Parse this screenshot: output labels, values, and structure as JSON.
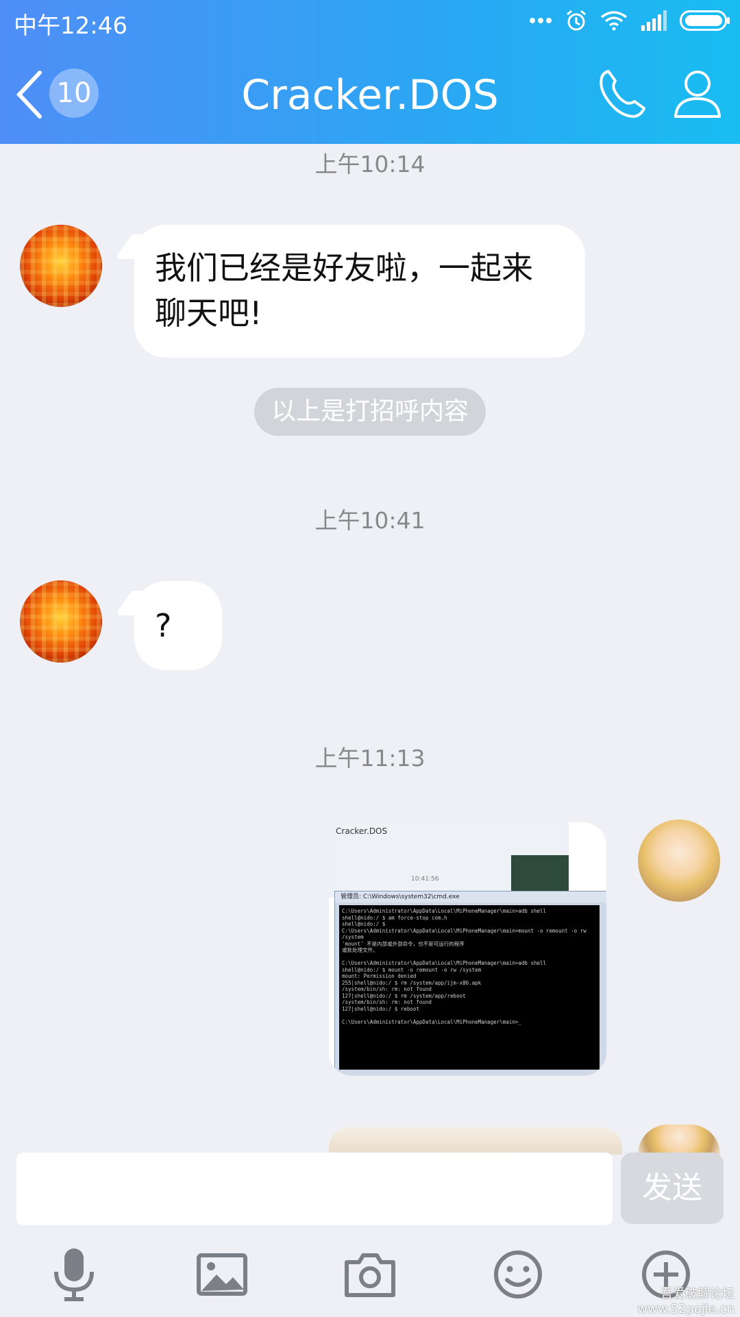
{
  "status_bar": {
    "time": "中午12:46"
  },
  "header": {
    "back_badge": "10",
    "title": "Cracker.DOS"
  },
  "messages": [
    {
      "timestamp": "上午10:14",
      "text_line1": "我们已经是好友啦，一起来",
      "text_line2": "聊天吧!"
    },
    {
      "system_pill": "以上是打招呼内容"
    },
    {
      "timestamp": "上午10:41",
      "text": "?"
    },
    {
      "timestamp": "上午11:13",
      "image": {
        "qq_title": "Cracker.DOS",
        "chat_time": "10:41:56",
        "cmd_title": "管理员: C:\\Windows\\system32\\cmd.exe",
        "cmd_text": "C:\\Users\\Administrator\\AppData\\Local\\MiPhoneManager\\main>adb shell\nshell@nido:/ $ am force-stop com.h\nshell@nido:/ $\nC:\\Users\\Administrator\\AppData\\Local\\MiPhoneManager\\main>mount -o remount -o rw\n/system\n'mount' 不是内部或外部命令，也不是可运行的程序\n或批处理文件。\n\nC:\\Users\\Administrator\\AppData\\Local\\MiPhoneManager\\main>adb shell\nshell@nido:/ $ mount -o remount -o rw /system\nmount: Permission denied\n255|shell@nido:/ $ rm /system/app/ijm-x86.apk\n/system/bin/sh: rm: not found\n127|shell@nido:/ $ rm /system/app/reboot\n/system/bin/sh: rm: not found\n127|shell@nido:/ $ reboot\n\nC:\\Users\\Administrator\\AppData\\Local\\MiPhoneManager\\main>_"
      }
    }
  ],
  "input": {
    "value": "",
    "send_label": "发送"
  },
  "toolbar": [
    "microphone-icon",
    "image-icon",
    "camera-icon",
    "emoji-icon",
    "plus-icon"
  ],
  "watermark": {
    "line1": "吾爱破解论坛",
    "line2": "www.52pojie.cn"
  },
  "colors": {
    "header_start": "#4f8ef7",
    "header_end": "#19bdf2",
    "background": "#eff0f5",
    "timestamp": "#888888"
  }
}
